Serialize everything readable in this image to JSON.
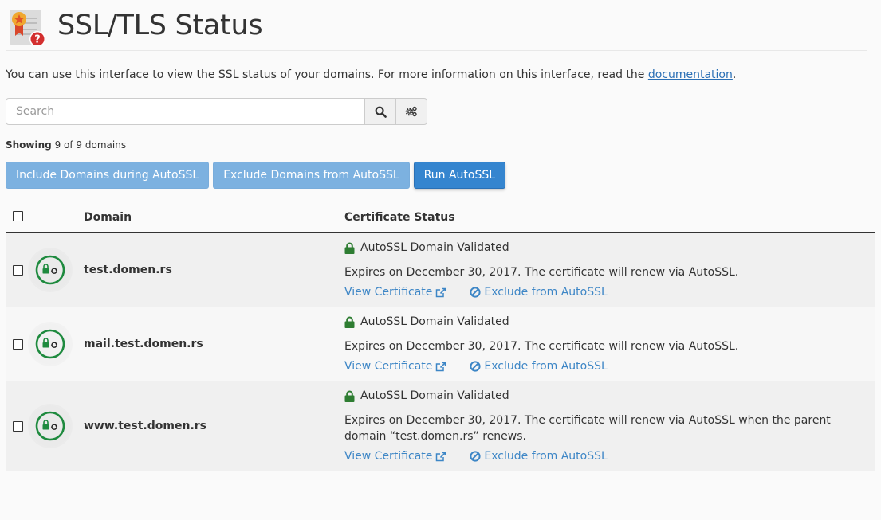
{
  "header": {
    "title": "SSL/TLS Status",
    "icon": "certificate-question-icon"
  },
  "description": {
    "text": "You can use this interface to view the SSL status of your domains. For more information on this interface, read the ",
    "link_label": "documentation",
    "suffix": "."
  },
  "search": {
    "placeholder": "Search",
    "value": "",
    "search_icon": "search-icon",
    "settings_icon": "gears-icon"
  },
  "showing": {
    "label": "Showing",
    "text": "9 of 9 domains"
  },
  "actions": {
    "include_label": "Include Domains during AutoSSL",
    "exclude_label": "Exclude Domains from AutoSSL",
    "run_label": "Run AutoSSL"
  },
  "table": {
    "columns": {
      "domain": "Domain",
      "status": "Certificate Status"
    },
    "rows": [
      {
        "domain": "test.domen.rs",
        "status": "AutoSSL Domain Validated",
        "expires": "Expires on December 30, 2017. The certificate will renew via AutoSSL.",
        "view_label": "View Certificate",
        "exclude_label": "Exclude from AutoSSL",
        "checked": false
      },
      {
        "domain": "mail.test.domen.rs",
        "status": "AutoSSL Domain Validated",
        "expires": "Expires on December 30, 2017. The certificate will renew via AutoSSL.",
        "view_label": "View Certificate",
        "exclude_label": "Exclude from AutoSSL",
        "checked": false
      },
      {
        "domain": "www.test.domen.rs",
        "status": "AutoSSL Domain Validated",
        "expires": "Expires on December 30, 2017. The certificate will renew via AutoSSL when the parent domain “test.domen.rs” renews.",
        "view_label": "View Certificate",
        "exclude_label": "Exclude from AutoSSL",
        "checked": false
      }
    ]
  },
  "colors": {
    "accent": "#3585cf",
    "accent_light": "#7cb1e0",
    "link": "#3d86c6",
    "valid_green": "#2e7d32",
    "icon_ring_green": "#1e8a3e"
  }
}
